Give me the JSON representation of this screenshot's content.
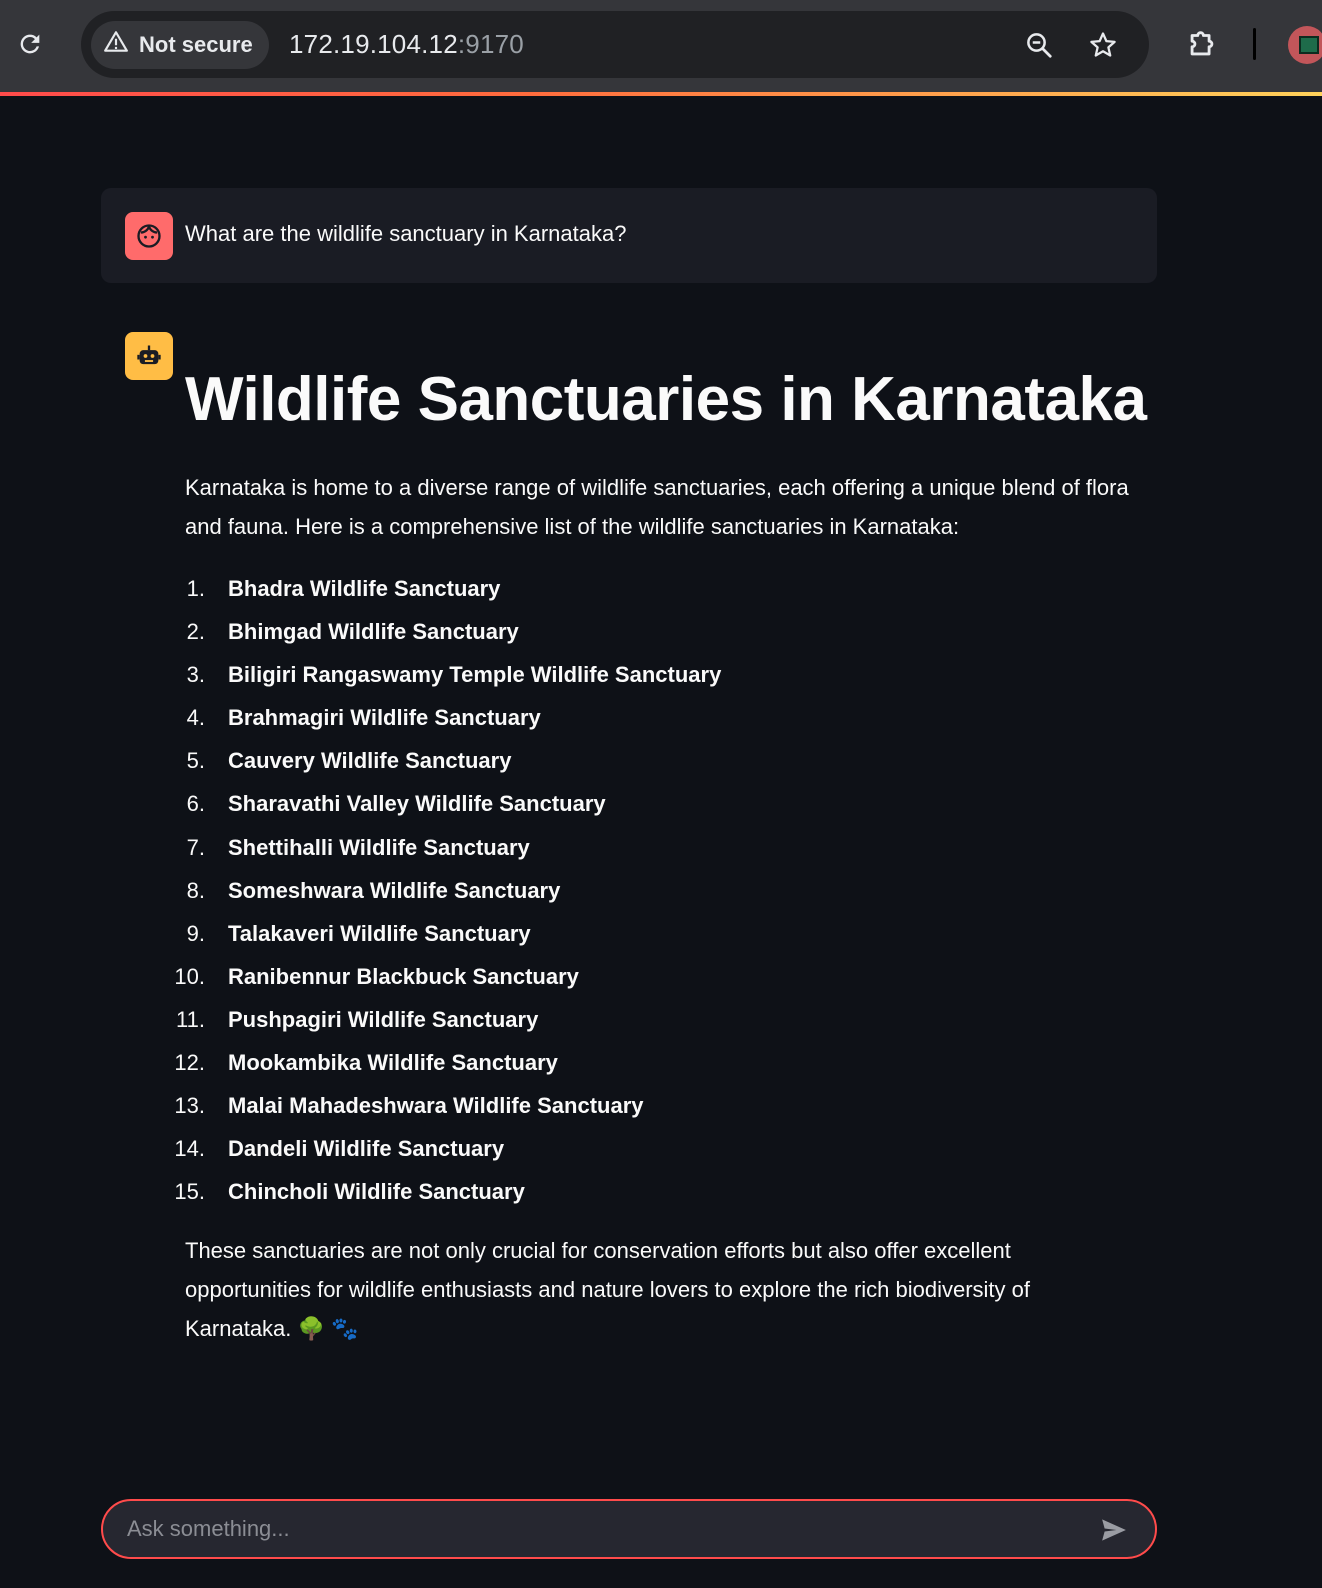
{
  "browser": {
    "security_label": "Not secure",
    "url_host": "172.19.104.12",
    "url_port": ":9170",
    "icons": [
      "reload-icon",
      "warning-icon",
      "zoom-icon",
      "star-icon",
      "extensions-icon",
      "profile-avatar"
    ]
  },
  "user_message": {
    "text": "What are the wildlife sanctuary in Karnataka?"
  },
  "assistant_message": {
    "title": "Wildlife Sanctuaries in Karnataka",
    "intro": "Karnataka is home to a diverse range of wildlife sanctuaries, each offering a unique blend of flora and fauna. Here is a comprehensive list of the wildlife sanctuaries in Karnataka:",
    "items": [
      {
        "num": "1.",
        "name": "Bhadra Wildlife Sanctuary"
      },
      {
        "num": "2.",
        "name": "Bhimgad Wildlife Sanctuary"
      },
      {
        "num": "3.",
        "name": "Biligiri Rangaswamy Temple Wildlife Sanctuary"
      },
      {
        "num": "4.",
        "name": "Brahmagiri Wildlife Sanctuary"
      },
      {
        "num": "5.",
        "name": "Cauvery Wildlife Sanctuary"
      },
      {
        "num": "6.",
        "name": "Sharavathi Valley Wildlife Sanctuary"
      },
      {
        "num": "7.",
        "name": "Shettihalli Wildlife Sanctuary"
      },
      {
        "num": "8.",
        "name": "Someshwara Wildlife Sanctuary"
      },
      {
        "num": "9.",
        "name": "Talakaveri Wildlife Sanctuary"
      },
      {
        "num": "10.",
        "name": "Ranibennur Blackbuck Sanctuary"
      },
      {
        "num": "11.",
        "name": "Pushpagiri Wildlife Sanctuary"
      },
      {
        "num": "12.",
        "name": "Mookambika Wildlife Sanctuary"
      },
      {
        "num": "13.",
        "name": "Malai Mahadeshwara Wildlife Sanctuary"
      },
      {
        "num": "14.",
        "name": "Dandeli Wildlife Sanctuary"
      },
      {
        "num": "15.",
        "name": "Chincholi Wildlife Sanctuary"
      }
    ],
    "outro": "These sanctuaries are not only crucial for conservation efforts but also offer excellent opportunities for wildlife enthusiasts and nature lovers to explore the rich biodiversity of Karnataka. 🌳 🐾"
  },
  "chat_input": {
    "placeholder": "Ask something...",
    "value": ""
  },
  "colors": {
    "background": "#0e1117",
    "user_bubble": "#1a1c24",
    "user_avatar": "#ff6b6b",
    "assistant_avatar": "#ffbd45",
    "input_border": "#ff4b4b"
  }
}
